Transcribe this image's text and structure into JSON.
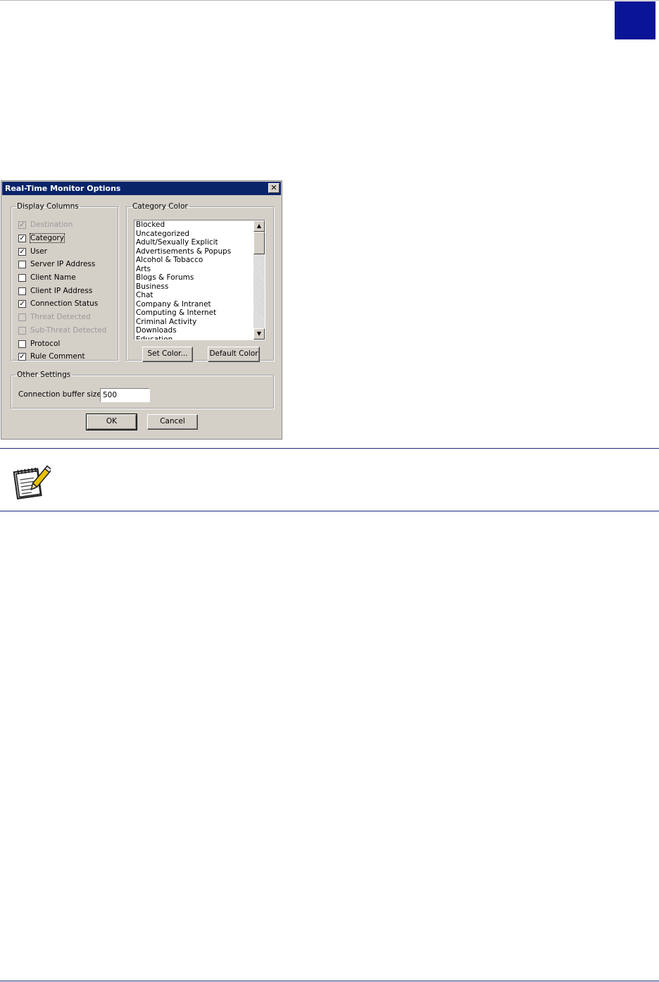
{
  "dialog": {
    "title": "Real-Time Monitor Options",
    "close_symbol": "✕",
    "display_columns": {
      "legend": "Display Columns",
      "items": [
        {
          "label": "Destination",
          "checked": true,
          "disabled": true
        },
        {
          "label": "Category",
          "checked": true,
          "disabled": false,
          "focused": true
        },
        {
          "label": "User",
          "checked": true,
          "disabled": false
        },
        {
          "label": "Server IP Address",
          "checked": false,
          "disabled": false
        },
        {
          "label": "Client Name",
          "checked": false,
          "disabled": false
        },
        {
          "label": "Client IP Address",
          "checked": false,
          "disabled": false
        },
        {
          "label": "Connection Status",
          "checked": true,
          "disabled": false
        },
        {
          "label": "Threat Detected",
          "checked": false,
          "disabled": true
        },
        {
          "label": "Sub-Threat Detected",
          "checked": false,
          "disabled": true
        },
        {
          "label": "Protocol",
          "checked": false,
          "disabled": false
        },
        {
          "label": "Rule Comment",
          "checked": true,
          "disabled": false
        }
      ]
    },
    "category_color": {
      "legend": "Category Color",
      "items": [
        "Blocked",
        "Uncategorized",
        "Adult/Sexually Explicit",
        "Advertisements & Popups",
        "Alcohol & Tobacco",
        "Arts",
        "Blogs & Forums",
        "Business",
        "Chat",
        "Company & Intranet",
        "Computing & Internet",
        "Criminal Activity",
        "Downloads",
        "Education"
      ],
      "set_color_label": "Set Color...",
      "default_color_label": "Default Color"
    },
    "other_settings": {
      "legend": "Other Settings",
      "buffer_label": "Connection buffer size:",
      "buffer_value": "500"
    },
    "ok_label": "OK",
    "cancel_label": "Cancel"
  },
  "icons": {
    "note": "notepad-pencil-icon"
  },
  "colors": {
    "tab_marker": "#0a1496",
    "title_bar": "#0a246a",
    "dialog_face": "#d4d0c8",
    "rule": "#1c2a7a"
  }
}
